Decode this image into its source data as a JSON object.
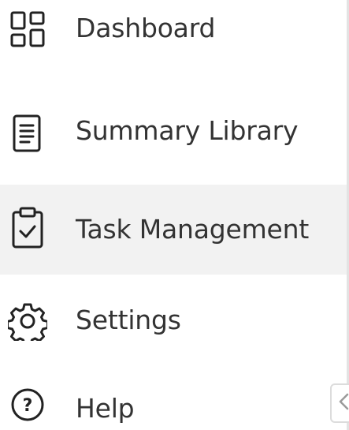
{
  "sidebar": {
    "items": [
      {
        "label": "Dashboard",
        "icon": "dashboard-grid-icon",
        "active": false
      },
      {
        "label": "Summary Library",
        "icon": "document-icon",
        "active": false
      },
      {
        "label": "Task Management",
        "icon": "clipboard-check-icon",
        "active": true
      },
      {
        "label": "Settings",
        "icon": "gear-icon",
        "active": false
      },
      {
        "label": "Help",
        "icon": "help-circle-icon",
        "active": false
      }
    ],
    "collapse_handle_icon": "chevron-left-icon"
  },
  "colors": {
    "text": "#333333",
    "icon_stroke": "#222222",
    "active_background": "#f2f2f2",
    "divider": "#e3e3e3"
  }
}
